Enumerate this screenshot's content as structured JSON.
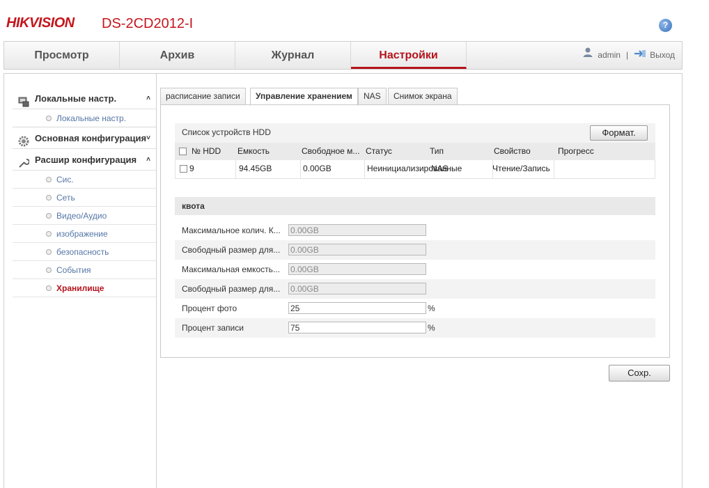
{
  "header": {
    "logo": "HIKVISION",
    "model": "DS-2CD2012-I",
    "help_icon": "?"
  },
  "nav": {
    "tabs": [
      {
        "label": "Просмотр"
      },
      {
        "label": "Архив"
      },
      {
        "label": "Журнал"
      },
      {
        "label": "Настройки",
        "active": true
      }
    ],
    "user": "admin",
    "separator": "|",
    "logout": "Выход"
  },
  "sidebar": {
    "groups": [
      {
        "label": "Локальные настр.",
        "icon": "local-config-icon",
        "expanded": true,
        "items": [
          {
            "label": "Локальные настр."
          }
        ]
      },
      {
        "label": "Основная конфигурация",
        "icon": "gear-icon",
        "expanded": false,
        "items": []
      },
      {
        "label": "Расшир конфигурация",
        "icon": "wrench-icon",
        "expanded": true,
        "items": [
          {
            "label": "Сис."
          },
          {
            "label": "Сеть"
          },
          {
            "label": "Видео/Аудио"
          },
          {
            "label": "изображение"
          },
          {
            "label": "безопасность"
          },
          {
            "label": "События"
          },
          {
            "label": "Хранилище",
            "active": true
          }
        ]
      }
    ]
  },
  "content_tabs": [
    {
      "label": "расписание записи"
    },
    {
      "label": "Управление хранением",
      "active": true
    },
    {
      "label": "NAS"
    },
    {
      "label": "Снимок экрана"
    }
  ],
  "hdd_list": {
    "title": "Список устройств HDD",
    "format_button": "Формат.",
    "columns": [
      "№ HDD",
      "Емкость",
      "Свободное м...",
      "Статус",
      "Тип",
      "Свойство",
      "Прогресс"
    ],
    "rows": [
      {
        "hdd_no": "9",
        "capacity": "94.45GB",
        "free": "0.00GB",
        "status": "Неинициализированные",
        "type": "NAS",
        "property": "Чтение/Запись",
        "progress": ""
      }
    ]
  },
  "quota": {
    "title": "квота",
    "rows": [
      {
        "label": "Максимальное колич. К...",
        "value": "0.00GB",
        "unit": "",
        "disabled": true
      },
      {
        "label": "Свободный размер для...",
        "value": "0.00GB",
        "unit": "",
        "disabled": true
      },
      {
        "label": "Максимальная емкость...",
        "value": "0.00GB",
        "unit": "",
        "disabled": true
      },
      {
        "label": "Свободный размер для...",
        "value": "0.00GB",
        "unit": "",
        "disabled": true
      },
      {
        "label": "Процент фото",
        "value": "25",
        "unit": "%",
        "disabled": false
      },
      {
        "label": "Процент записи",
        "value": "75",
        "unit": "%",
        "disabled": false
      }
    ]
  },
  "save_button": "Сохр.",
  "colors": {
    "brand_red": "#c4161c",
    "active_red": "#b5121b",
    "link_blue": "#5576a6"
  }
}
